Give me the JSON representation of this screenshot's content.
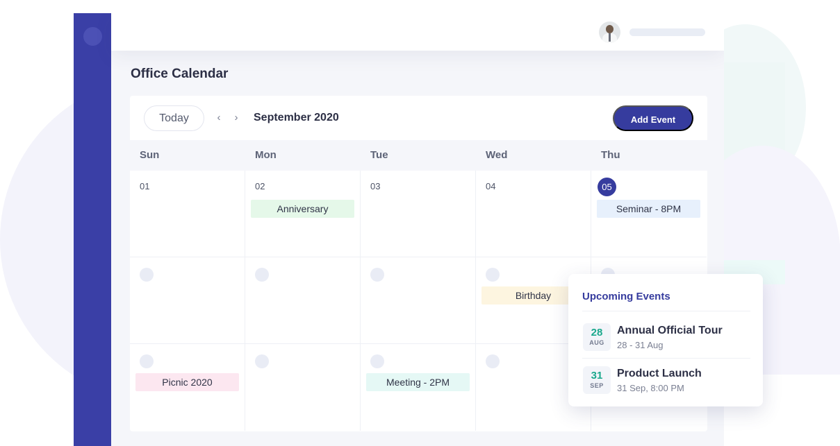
{
  "page": {
    "title": "Office Calendar"
  },
  "toolbar": {
    "today_label": "Today",
    "prev_icon": "‹",
    "next_icon": "›",
    "month": "September 2020",
    "add_event_label": "Add Event"
  },
  "weekdays": [
    "Sun",
    "Mon",
    "Tue",
    "Wed",
    "Thu"
  ],
  "week1": {
    "days": [
      "01",
      "02",
      "03",
      "04",
      "05"
    ],
    "events": {
      "mon": {
        "label": "Anniversary",
        "color": "#e5f8e9"
      },
      "thu": {
        "label": "Seminar - 8PM",
        "color": "#e7f0fc"
      }
    }
  },
  "week2": {
    "events": {
      "wed": {
        "label": "Birthday",
        "color": "#fdf5e0"
      }
    }
  },
  "week3": {
    "events": {
      "sun": {
        "label": "Picnic 2020",
        "color": "#fce7f0"
      },
      "tue": {
        "label": "Meeting - 2PM",
        "color": "#e5f8f5"
      }
    }
  },
  "upcoming": {
    "title": "Upcoming Events",
    "items": [
      {
        "day": "28",
        "month": "AUG",
        "name": "Annual Official Tour",
        "detail": "28 - 31 Aug"
      },
      {
        "day": "31",
        "month": "SEP",
        "name": "Product Launch",
        "detail": "31 Sep, 8:00 PM"
      }
    ]
  },
  "colors": {
    "sidebar": "#3a3fa6",
    "accent": "#363c9e",
    "date_teal": "#1aa88c"
  },
  "icons": {
    "logo": "app-logo-icon",
    "avatar": "user-avatar",
    "prev": "chevron-left-icon",
    "next": "chevron-right-icon"
  }
}
